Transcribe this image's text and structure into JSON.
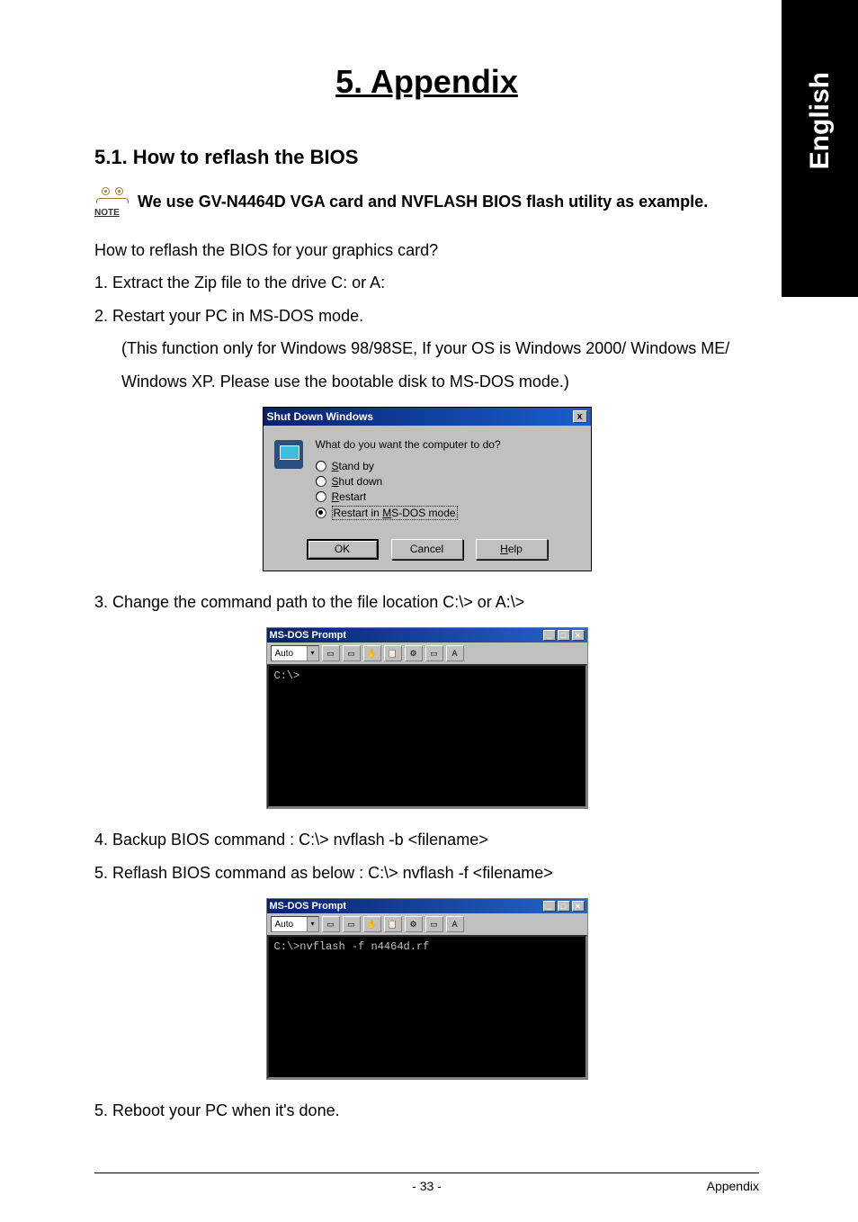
{
  "side_tab": "English",
  "title": "5. Appendix",
  "section_heading": "5.1. How to reflash the BIOS",
  "note_icon_label": "NOTE",
  "note_text": "We use GV-N4464D VGA card and NVFLASH BIOS flash utility as example.",
  "intro_q": "How to reflash the BIOS for your graphics card?",
  "step1": "1.  Extract the Zip file to the drive C: or A:",
  "step2": "2.  Restart your PC in MS-DOS mode.",
  "step2a": "(This function only for Windows 98/98SE, If your OS is Windows 2000/ Windows ME/",
  "step2b": "Windows XP. Please use the bootable disk to MS-DOS mode.)",
  "dialog": {
    "title": "Shut Down Windows",
    "close": "x",
    "question": "What do you want the computer to do?",
    "options": {
      "standby": "Stand by",
      "shutdown": "Shut down",
      "restart": "Restart",
      "msdos_pre": "Restart in ",
      "msdos_u": "M",
      "msdos_post": "S-DOS mode"
    },
    "buttons": {
      "ok": "OK",
      "cancel": "Cancel",
      "help": "Help"
    }
  },
  "step3": "3. Change the command path to the file location C:\\> or A:\\>",
  "dos1": {
    "title": "MS-DOS Prompt",
    "toolbar_select": "Auto",
    "line": "C:\\>"
  },
  "step4": "4. Backup BIOS command : C:\\> nvflash -b <filename>",
  "step5": "5. Reflash BIOS command as below : C:\\> nvflash -f <filename>",
  "dos2": {
    "title": "MS-DOS Prompt",
    "toolbar_select": "Auto",
    "line": "C:\\>nvflash -f n4464d.rf"
  },
  "step6": "5. Reboot your PC when it's done.",
  "footer": {
    "page": "- 33 -",
    "section": "Appendix"
  }
}
